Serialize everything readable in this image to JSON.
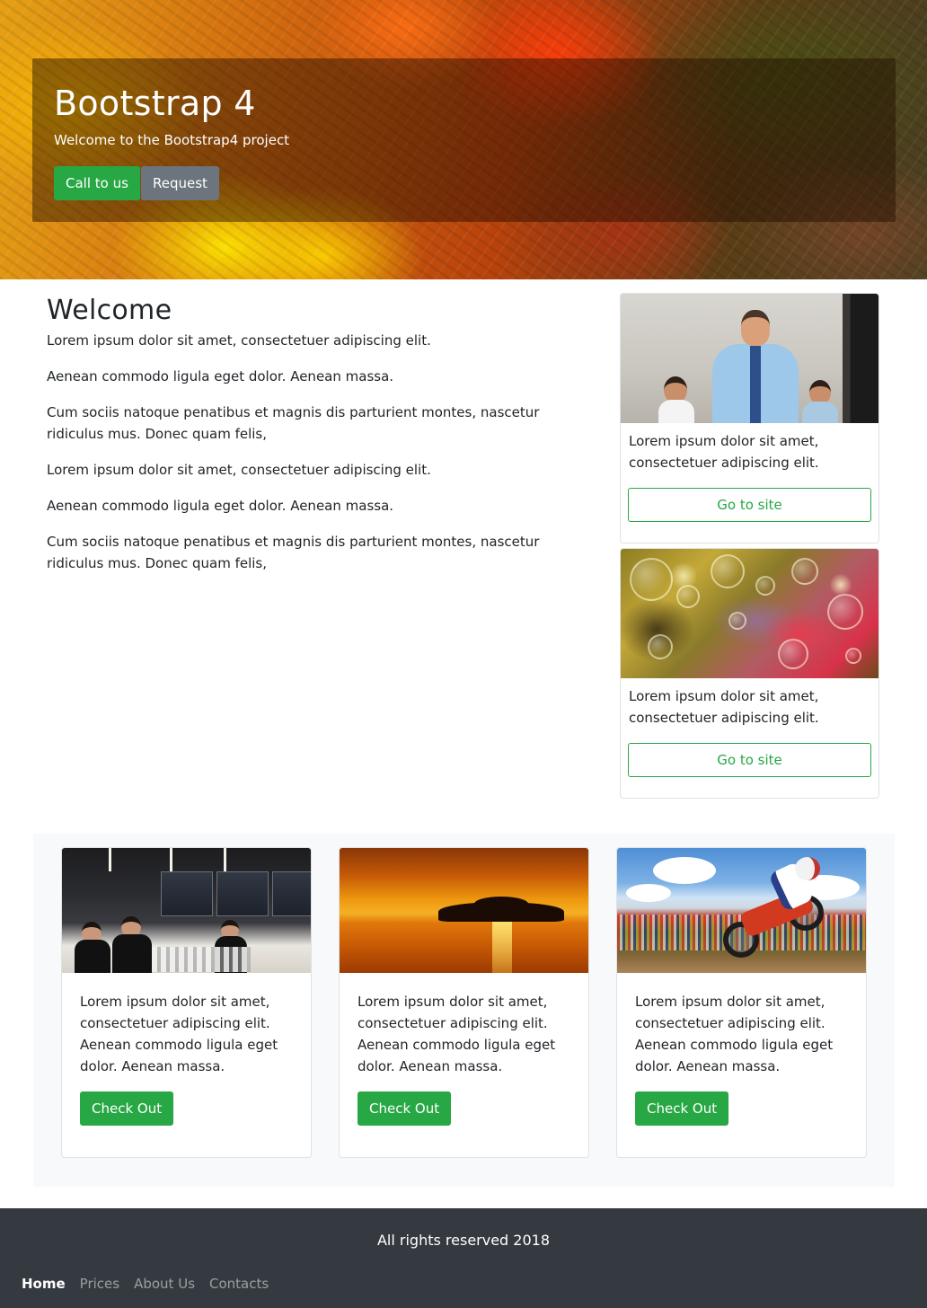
{
  "hero": {
    "title": "Bootstrap 4",
    "lead": "Welcome to the Bootstrap4 project",
    "call_button": "Call to us",
    "request_button": "Request"
  },
  "welcome": {
    "heading": "Welcome",
    "paragraphs": [
      "Lorem ipsum dolor sit amet, consectetuer adipiscing elit.",
      "Aenean commodo ligula eget dolor. Aenean massa.",
      "Cum sociis natoque penatibus et magnis dis parturient montes, nascetur ridiculus mus. Donec quam felis,",
      "Lorem ipsum dolor sit amet, consectetuer adipiscing elit.",
      "Aenean commodo ligula eget dolor. Aenean massa.",
      "Cum sociis natoque penatibus et magnis dis parturient montes, nascetur ridiculus mus. Donec quam felis,"
    ]
  },
  "side_cards": [
    {
      "image": "office-people-photo",
      "text": "Lorem ipsum dolor sit amet, consectetuer adipiscing elit.",
      "button": "Go to site"
    },
    {
      "image": "oil-bubbles-photo",
      "text": "Lorem ipsum dolor sit amet, consectetuer adipiscing elit.",
      "button": "Go to site"
    }
  ],
  "feature_cards": [
    {
      "image": "bar-party-photo",
      "text": "Lorem ipsum dolor sit amet, consectetuer adipiscing elit. Aenean commodo ligula eget dolor. Aenean massa.",
      "button": "Check Out"
    },
    {
      "image": "sunset-island-photo",
      "text": "Lorem ipsum dolor sit amet, consectetuer adipiscing elit. Aenean commodo ligula eget dolor. Aenean massa.",
      "button": "Check Out"
    },
    {
      "image": "motocross-photo",
      "text": "Lorem ipsum dolor sit amet, consectetuer adipiscing elit. Aenean commodo ligula eget dolor. Aenean massa.",
      "button": "Check Out"
    }
  ],
  "footer": {
    "rights": "All rights reserved 2018",
    "nav": [
      {
        "label": "Home",
        "active": true
      },
      {
        "label": "Prices",
        "active": false
      },
      {
        "label": "About Us",
        "active": false
      },
      {
        "label": "Contacts",
        "active": false
      }
    ]
  },
  "colors": {
    "success": "#28a745",
    "secondary": "#6c757d",
    "footer_bg": "#343a40",
    "section_bg": "#f8f9fa",
    "card_border": "#dee2e6"
  }
}
